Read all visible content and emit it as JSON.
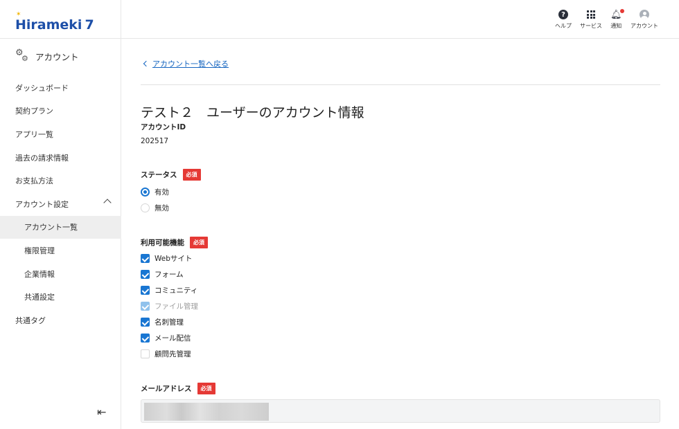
{
  "brand": {
    "name": "irameki",
    "number": "7",
    "initial": "H"
  },
  "sidebar": {
    "section_title": "アカウント",
    "items": [
      {
        "label": "ダッシュボード"
      },
      {
        "label": "契約プラン"
      },
      {
        "label": "アプリ一覧"
      },
      {
        "label": "過去の請求情報"
      },
      {
        "label": "お支払方法"
      },
      {
        "label": "アカウント設定"
      },
      {
        "label": "アカウント一覧"
      },
      {
        "label": "権限管理"
      },
      {
        "label": "企業情報"
      },
      {
        "label": "共通設定"
      },
      {
        "label": "共通タグ"
      }
    ],
    "collapse_glyph": "⇤"
  },
  "topbar": {
    "help": "ヘルプ",
    "services": "サービス",
    "notifications": "通知",
    "account": "アカウント"
  },
  "main": {
    "back_link": "アカウント一覧へ戻る",
    "title": "テスト２　ユーザーのアカウント情報",
    "account_id_label": "アカウントID",
    "account_id_value": "202517",
    "required_badge": "必須",
    "status": {
      "label": "ステータス",
      "options": [
        {
          "label": "有効",
          "selected": true
        },
        {
          "label": "無効",
          "selected": false
        }
      ]
    },
    "features": {
      "label": "利用可能機能",
      "options": [
        {
          "label": "Webサイト",
          "checked": true
        },
        {
          "label": "フォーム",
          "checked": true
        },
        {
          "label": "コミュニティ",
          "checked": true
        },
        {
          "label": "ファイル管理",
          "checked": true,
          "disabled": true
        },
        {
          "label": "名刺管理",
          "checked": true
        },
        {
          "label": "メール配信",
          "checked": true
        },
        {
          "label": "顧問先管理",
          "checked": false
        }
      ]
    },
    "email": {
      "label": "メールアドレス"
    }
  },
  "colors": {
    "brand": "#1d4fa8",
    "accent": "#1976d2",
    "required": "#e53935",
    "link": "#1565c0"
  }
}
